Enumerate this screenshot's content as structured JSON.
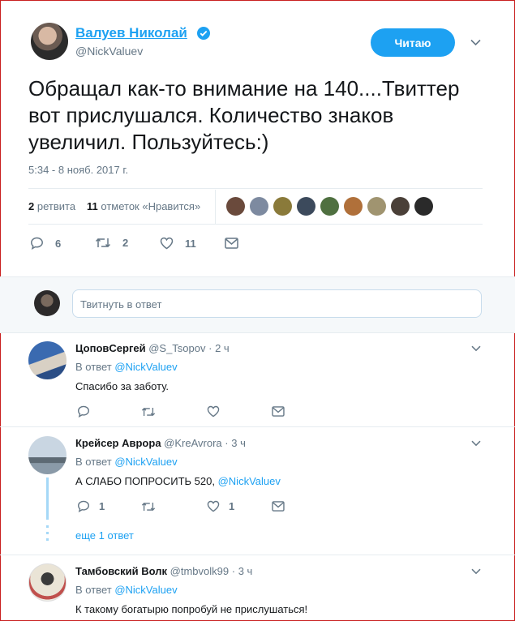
{
  "tweet": {
    "author_name": "Валуев Николай",
    "handle": "@NickValuev",
    "follow_label": "Читаю",
    "text": "Обращал как-то внимание на 140....Твиттер вот прислушался. Количество знаков увеличил. Пользуйтесь:)",
    "timestamp": "5:34 - 8 нояб. 2017 г.",
    "retweets_count": "2",
    "retweets_label": "ретвита",
    "likes_count": "11",
    "likes_label": "отметок «Нравится»",
    "actions": {
      "reply_count": "6",
      "retweet_count": "2",
      "like_count": "11"
    }
  },
  "reply_box": {
    "placeholder": "Твитнуть в ответ"
  },
  "replies": [
    {
      "name": "ЦоповСергей",
      "handle": "@S_Tsopov",
      "time": "· 2 ч",
      "in_reply_prefix": "В ответ",
      "in_reply_to": "@NickValuev",
      "text": "Спасибо за заботу."
    },
    {
      "name": "Крейсер Аврора",
      "handle": "@KreAvrora",
      "time": "· 3 ч",
      "in_reply_prefix": "В ответ",
      "in_reply_to": "@NickValuev",
      "text": "А СЛАБО ПОПРОСИТЬ 520,",
      "mention": "@NickValuev",
      "reply_count": "1",
      "like_count": "1",
      "more_label": "еще 1 ответ"
    },
    {
      "name": "Тамбовский Волк",
      "handle": "@tmbvolk99",
      "time": "· 3 ч",
      "in_reply_prefix": "В ответ",
      "in_reply_to": "@NickValuev",
      "text": "К такому богатырю попробуй не прислушаться!"
    }
  ],
  "colors": {
    "accent": "#1da1f2",
    "gray": "#657786",
    "border": "#e6ecf0",
    "frame": "#c9201f"
  }
}
